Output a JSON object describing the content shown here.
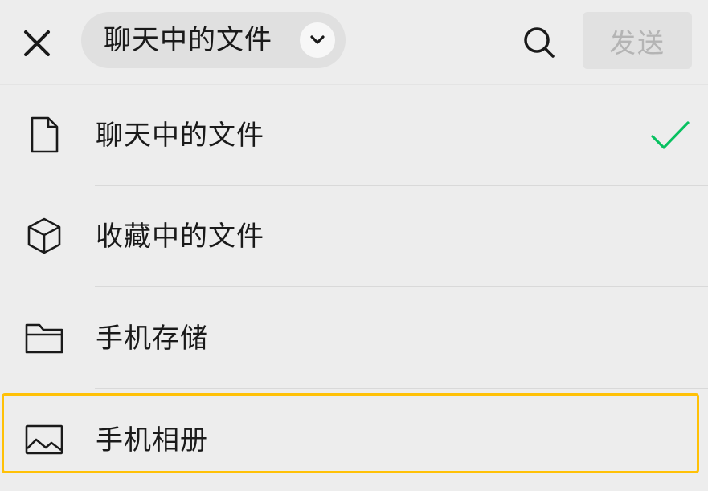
{
  "header": {
    "source_selector_label": "聊天中的文件",
    "send_label": "发送",
    "close_icon": "close-icon",
    "search_icon": "search-icon",
    "chevron_icon": "chevron-down-icon"
  },
  "menu": {
    "items": [
      {
        "label": "聊天中的文件",
        "icon": "file-icon",
        "selected": true
      },
      {
        "label": "收藏中的文件",
        "icon": "cube-icon",
        "selected": false
      },
      {
        "label": "手机存储",
        "icon": "folder-icon",
        "selected": false
      },
      {
        "label": "手机相册",
        "icon": "image-icon",
        "selected": false
      }
    ]
  },
  "colors": {
    "background": "#ededed",
    "check": "#07c160",
    "highlight": "#ffc107",
    "send_disabled_text": "#b4b4b4"
  }
}
